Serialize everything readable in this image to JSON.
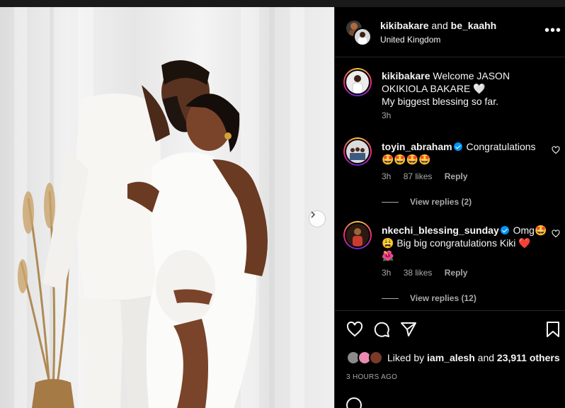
{
  "post": {
    "author": "kikibakare",
    "connector": "and",
    "collaborator": "be_kaahh",
    "location": "United Kingdom",
    "more_label": "•••"
  },
  "caption": {
    "username": "kikibakare",
    "text": "Welcome JASON OKIKIOLA BAKARE 🤍",
    "text2": "My biggest blessing so far.",
    "time": "3h"
  },
  "comments": [
    {
      "username": "toyin_abraham",
      "verified": true,
      "text": "Congratulations",
      "emoji": "🤩🤩🤩🤩",
      "time": "3h",
      "likes": "87 likes",
      "reply": "Reply",
      "view_replies": "View replies (2)"
    },
    {
      "username": "nkechi_blessing_sunday",
      "verified": true,
      "text": "Omg🤩",
      "text2": "😩 Big big congratulations Kiki ❤️",
      "text3": "🌺",
      "time": "3h",
      "likes": "38 likes",
      "reply": "Reply",
      "view_replies": "View replies (12)"
    }
  ],
  "actions": {
    "liked_by_prefix": "Liked by",
    "liked_by_user": "iam_alesh",
    "liked_by_suffix": "and",
    "others": "23,911 others",
    "time_ago": "3 HOURS AGO"
  },
  "icons": {
    "like": "heart-icon",
    "comment": "comment-icon",
    "share": "share-icon",
    "save": "bookmark-icon",
    "next": "chevron-right-icon",
    "more": "more-icon"
  },
  "colors": {
    "background": "#000000",
    "text": "#f5f5f5",
    "muted": "#a8a8a8",
    "verified": "#0095f6",
    "divider": "#262626"
  }
}
